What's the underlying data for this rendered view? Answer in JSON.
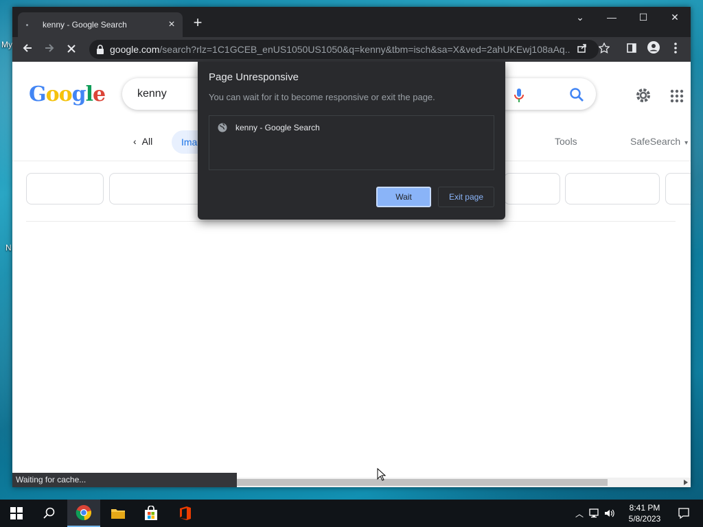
{
  "desktop": {
    "labels": [
      "My",
      "N"
    ]
  },
  "browser": {
    "tab": {
      "title": "kenny - Google Search",
      "close": "×"
    },
    "new_tab": "+",
    "window_controls": {
      "dropdown": "⌄",
      "minimize": "—",
      "maximize": "☐",
      "close": "✕"
    },
    "toolbar": {
      "url_host": "google.com",
      "url_path": "/search?rlz=1C1GCEB_enUS1050US1050&q=kenny&tbm=isch&sa=X&ved=2ahUKEwj108aAq..."
    },
    "status": "Waiting for cache..."
  },
  "page": {
    "logo": "Google",
    "search_query": "kenny",
    "nav": {
      "all": "All",
      "images": "Imag",
      "tools": "Tools",
      "safesearch": "SafeSearch"
    }
  },
  "dialog": {
    "title": "Page Unresponsive",
    "message": "You can wait for it to become responsive or exit the page.",
    "page_item": "kenny - Google Search",
    "wait_label": "Wait",
    "exit_label": "Exit page"
  },
  "taskbar": {
    "time": "8:41 PM",
    "date": "5/8/2023"
  },
  "colors": {
    "dialog_bg": "#292a2d",
    "accent_blue": "#8ab4f8",
    "chrome_dark": "#202124"
  }
}
